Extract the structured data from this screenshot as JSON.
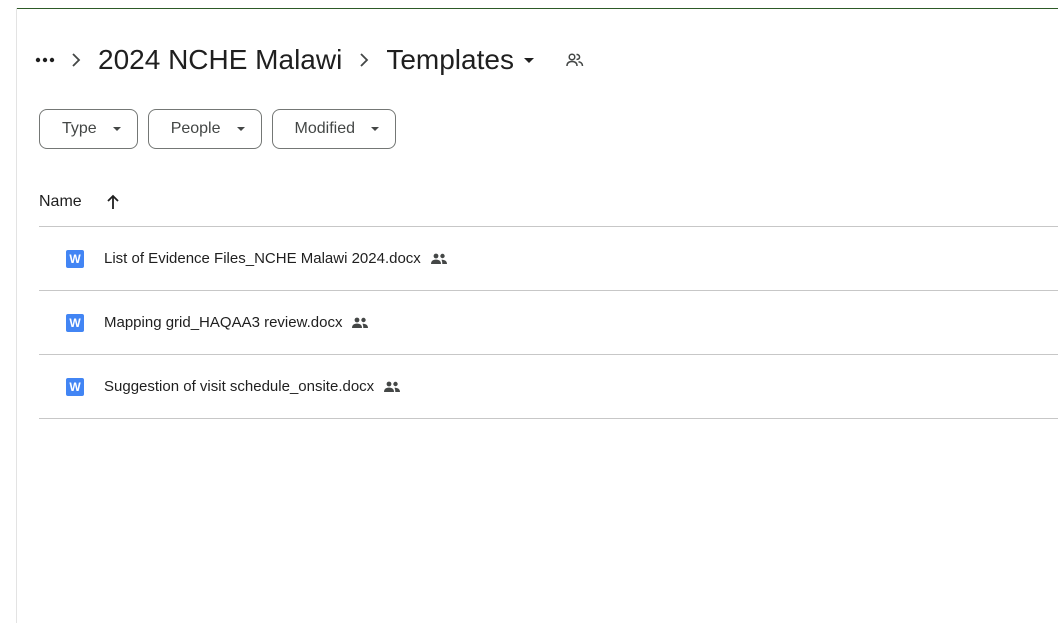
{
  "breadcrumb": {
    "more_label": "More folders",
    "parent": "2024 NCHE Malawi",
    "current": "Templates"
  },
  "filters": [
    {
      "label": "Type"
    },
    {
      "label": "People"
    },
    {
      "label": "Modified"
    }
  ],
  "columns": {
    "name": "Name"
  },
  "files": [
    {
      "name": "List of Evidence Files_NCHE Malawi 2024.docx",
      "icon": "W"
    },
    {
      "name": "Mapping grid_HAQAA3 review.docx",
      "icon": "W"
    },
    {
      "name": "Suggestion of visit schedule_onsite.docx",
      "icon": "W"
    }
  ],
  "colors": {
    "word_icon": "#4285f4",
    "top_border": "#2d5a27"
  }
}
